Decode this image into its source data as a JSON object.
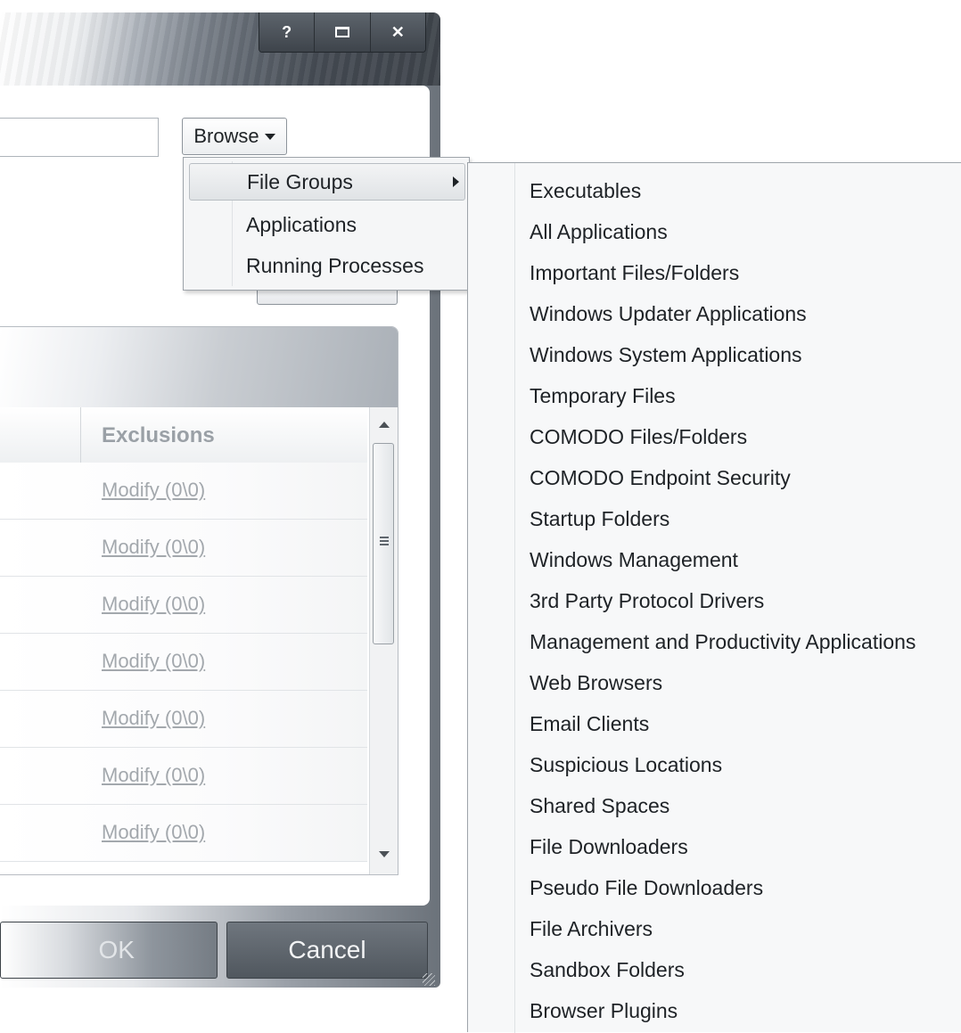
{
  "window": {
    "caption_buttons": {
      "help": "?",
      "close": "✕"
    }
  },
  "browse": {
    "label": "Browse",
    "path_value": ""
  },
  "table": {
    "column_header": "Exclusions",
    "rows": [
      "Modify (0\\0)",
      "Modify (0\\0)",
      "Modify (0\\0)",
      "Modify (0\\0)",
      "Modify (0\\0)",
      "Modify (0\\0)",
      "Modify (0\\0)"
    ]
  },
  "buttons": {
    "ok": "OK",
    "cancel": "Cancel"
  },
  "browse_menu": {
    "items": [
      "File Groups",
      "Applications",
      "Running Processes"
    ]
  },
  "file_groups_submenu": {
    "items": [
      "Executables",
      "All Applications",
      "Important Files/Folders",
      "Windows Updater Applications",
      "Windows System Applications",
      "Temporary Files",
      "COMODO Files/Folders",
      "COMODO Endpoint Security",
      "Startup Folders",
      "Windows Management",
      "3rd Party Protocol Drivers",
      "Management and Productivity Applications",
      "Web Browsers",
      "Email Clients",
      "Suspicious Locations",
      "Shared Spaces",
      "File Downloaders",
      "Pseudo File Downloaders",
      "File Archivers",
      "Sandbox Folders",
      "Browser Plugins"
    ]
  }
}
